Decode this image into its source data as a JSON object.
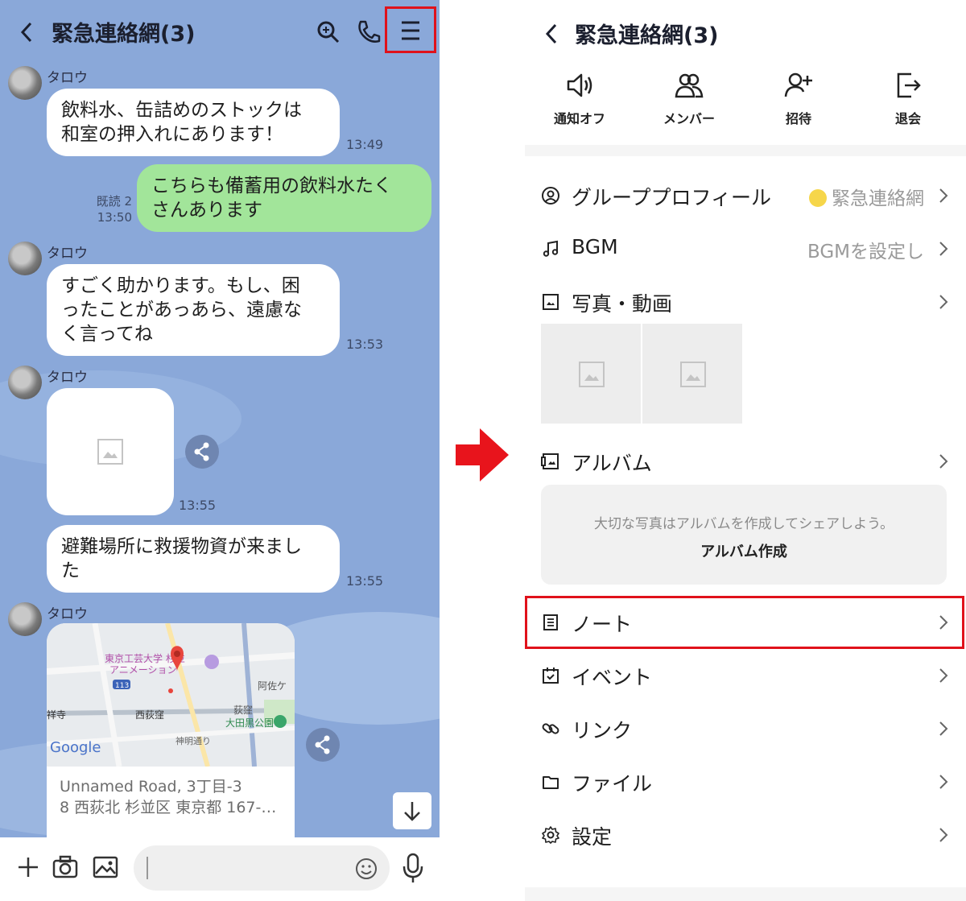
{
  "chat": {
    "title": "緊急連絡網(3)",
    "sender_name": "タロウ",
    "messages": [
      {
        "from": "other",
        "lines": [
          "飲料水、缶詰めのストックは",
          "和室の押入れにあります！"
        ],
        "time": "13:49"
      },
      {
        "from": "me",
        "lines": [
          "こちらも備蓄用の飲料水たく",
          "さんあります"
        ],
        "read": "既読 2",
        "time": "13:50"
      },
      {
        "from": "other",
        "lines": [
          "すごく助かります。もし、困",
          "ったことがあっあら、遠慮な",
          "く言ってね"
        ],
        "time": "13:53"
      },
      {
        "from": "other",
        "type": "image",
        "time": "13:55"
      },
      {
        "from": "other",
        "lines": [
          "避難場所に救援物資が来まし",
          "た"
        ],
        "time": "13:55"
      }
    ],
    "map": {
      "address_line1": "Unnamed Road, 3丁目-3",
      "address_line2": "8 西荻北 杉並区 東京都 167-…",
      "labels": [
        "東京工芸大学 杉並",
        "アニメーション",
        "阿佐ケ",
        "西荻窪",
        "荻窪",
        "大田黒公園",
        "神明通り",
        "祥寺",
        "Google"
      ],
      "road_badge": "113"
    }
  },
  "settings": {
    "title": "緊急連絡網(3)",
    "actions": [
      {
        "label": "通知オフ",
        "icon": "speaker-icon"
      },
      {
        "label": "メンバー",
        "icon": "members-icon"
      },
      {
        "label": "招待",
        "icon": "invite-icon"
      },
      {
        "label": "退会",
        "icon": "leave-icon"
      }
    ],
    "rows": {
      "profile": {
        "label": "グループプロフィール",
        "value": "緊急連絡網"
      },
      "bgm": {
        "label": "BGM",
        "value": "BGMを設定し"
      },
      "photos": {
        "label": "写真・動画"
      },
      "album": {
        "label": "アルバム"
      },
      "note": {
        "label": "ノート"
      },
      "event": {
        "label": "イベント"
      },
      "link": {
        "label": "リンク"
      },
      "file": {
        "label": "ファイル"
      },
      "setting": {
        "label": "設定"
      }
    },
    "album_empty": {
      "message": "大切な写真はアルバムを作成してシェアしよう。",
      "button": "アルバム作成"
    }
  },
  "colors": {
    "chat_bg": "#8aa8d9",
    "my_bubble": "#a2e59a",
    "highlight": "#e0121b"
  }
}
